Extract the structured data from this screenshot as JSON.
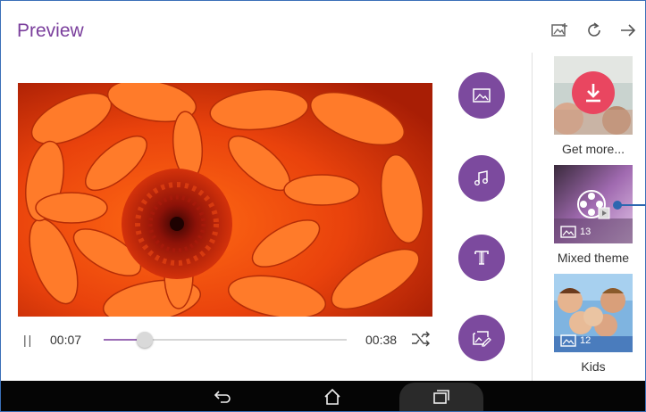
{
  "header": {
    "title": "Preview",
    "icons": [
      "add-photo-icon",
      "refresh-icon",
      "next-arrow-icon"
    ]
  },
  "player": {
    "current_time": "00:07",
    "end_time": "00:38",
    "progress": 0.17,
    "pause_icon": "pause-icon",
    "shuffle_icon": "shuffle-icon"
  },
  "tools": [
    "image-icon",
    "music-icon",
    "text-icon",
    "edit-image-icon"
  ],
  "themes": [
    {
      "label": "Get more...",
      "icon": "download-icon"
    },
    {
      "label": "Mixed theme",
      "count": "13",
      "icon": "film-reel-icon"
    },
    {
      "label": "Kids",
      "count": "12"
    }
  ],
  "navbar": {
    "icons": [
      "back-icon",
      "home-icon",
      "recents-icon"
    ]
  },
  "colors": {
    "accent": "#7c4a9e",
    "title": "#7a3e9c",
    "download": "#e94660",
    "selector": "#2b67b0"
  }
}
